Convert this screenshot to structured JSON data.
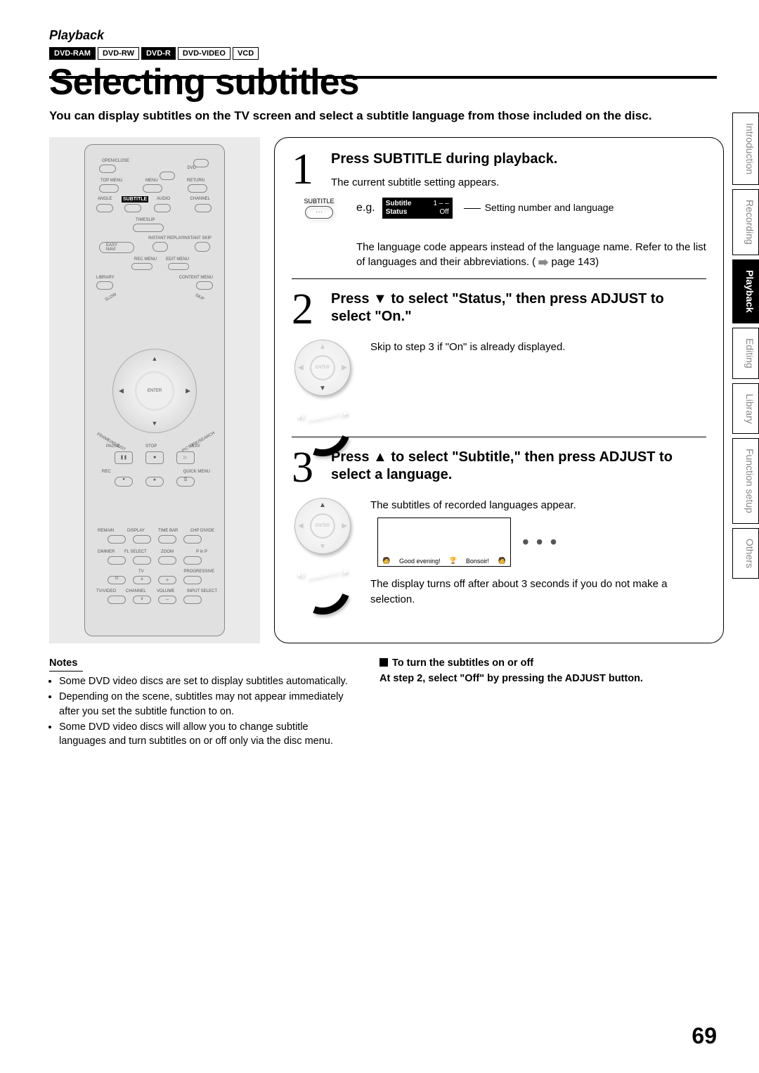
{
  "header": {
    "section": "Playback",
    "badges": [
      {
        "label": "DVD-RAM",
        "style": "dark"
      },
      {
        "label": "DVD-RW",
        "style": "light"
      },
      {
        "label": "DVD-R",
        "style": "dark"
      },
      {
        "label": "DVD-VIDEO",
        "style": "light"
      },
      {
        "label": "VCD",
        "style": "light"
      }
    ],
    "title": "Selecting subtitles",
    "intro": "You can display subtitles on the TV screen and select a subtitle language from those included on the disc."
  },
  "remote": {
    "labels": {
      "open_close": "OPEN/CLOSE",
      "dvd": "DVD",
      "top_menu": "TOP MENU",
      "menu": "MENU",
      "return": "RETURN",
      "angle": "ANGLE",
      "subtitle": "SUBTITLE",
      "audio": "AUDIO",
      "channel": "CHANNEL",
      "timeslip": "TIMESLIP",
      "instant_replay": "INSTANT REPLAY",
      "instant_skip": "INSTANT SKIP",
      "easy_navi": "EASY NAVI",
      "rec_menu": "REC MENU",
      "edit_menu": "EDIT MENU",
      "library": "LIBRARY",
      "content_menu": "CONTENT MENU",
      "slow": "SLOW",
      "skip": "SKIP",
      "enter": "ENTER",
      "frame_adjust": "FRAME/ADJUST",
      "picture_search": "PICTURE/SEARCH",
      "pause": "PAUSE",
      "stop": "STOP",
      "play": "PLAY",
      "rec": "REC",
      "quick_menu": "QUICK MENU",
      "remain": "REMAIN",
      "display": "DISPLAY",
      "time_bar": "TIME BAR",
      "chp_divide": "CHP DIVIDE",
      "dimmer": "DIMMER",
      "fl_select": "FL SELECT",
      "zoom": "ZOOM",
      "p_in_p": "P in P",
      "tv": "TV",
      "progressive": "PROGRESSIVE",
      "tv_video": "TV/VIDEO",
      "channel_low": "CHANNEL",
      "volume": "VOLUME",
      "input_select": "INPUT SELECT"
    }
  },
  "steps": [
    {
      "num": "1",
      "heading": "Press SUBTITLE during playback.",
      "line1": "The current subtitle setting appears.",
      "btn_label": "SUBTITLE",
      "eg": "e.g.",
      "osd": {
        "row1_label": "Subtitle",
        "row1_val": "1  – –",
        "row2_label": "Status",
        "row2_val": "Off"
      },
      "annot": "Setting number and language",
      "body2": "The language code appears instead of the language name. Refer to the list of languages and their abbreviations. (",
      "body2_page": " page 143)"
    },
    {
      "num": "2",
      "heading": "Press ▼ to select \"Status,\" then press ADJUST to select \"On.\"",
      "body": "Skip to step 3 if \"On\" is already displayed.",
      "arc_label": "FRAME/ADJUST"
    },
    {
      "num": "3",
      "heading": "Press ▲ to select \"Subtitle,\" then press ADJUST to select a language.",
      "line1": "The subtitles of recorded languages appear.",
      "cartoon": {
        "left": "Good evening!",
        "right": "Bonsoir!"
      },
      "body2": "The display turns off after about 3 seconds if you do not make a selection.",
      "arc_label": "FRAME/ADJUST"
    }
  ],
  "notes": {
    "heading": "Notes",
    "items": [
      "Some DVD video discs are set to display subtitles automatically.",
      "Depending on the scene, subtitles may not appear immediately after you set the subtitle function to on.",
      "Some DVD video discs will allow you to change subtitle languages and turn subtitles on or off only via the disc menu."
    ]
  },
  "right_block": {
    "heading": "To turn the subtitles on or off",
    "body": "At step 2, select \"Off\" by pressing the ADJUST button."
  },
  "side_tabs": [
    "Introduction",
    "Recording",
    "Playback",
    "Editing",
    "Library",
    "Function setup",
    "Others"
  ],
  "active_tab": "Playback",
  "page_number": "69"
}
